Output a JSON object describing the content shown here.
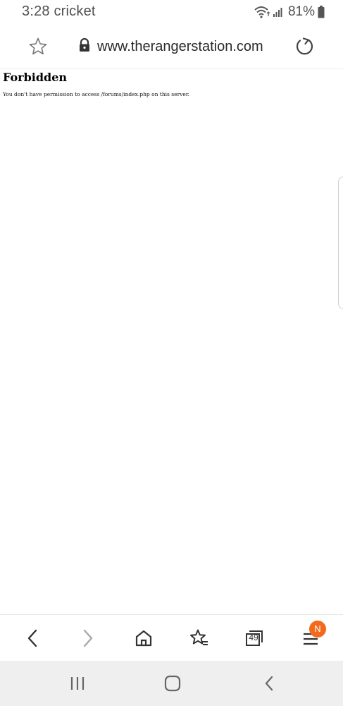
{
  "status_bar": {
    "time_carrier": "3:28 cricket",
    "battery_percent": "81%",
    "icons": [
      "wifi-icon",
      "signal-icon",
      "battery-icon"
    ]
  },
  "url_bar": {
    "url": "www.therangerstation.com",
    "icons": [
      "star-icon",
      "lock-icon",
      "reload-icon"
    ]
  },
  "page": {
    "title": "Forbidden",
    "message": "You don't have permission to access /forums/index.php on this server."
  },
  "toolbar": {
    "icons": [
      "back-icon",
      "forward-icon",
      "home-icon",
      "bookmarks-icon",
      "tabs-icon",
      "menu-icon"
    ],
    "tabs_count": "49",
    "badge": "N",
    "badge_color": "#f26b1d"
  },
  "nav_bar": {
    "icons": [
      "recent-apps-icon",
      "home-nav-icon",
      "back-nav-icon"
    ]
  }
}
